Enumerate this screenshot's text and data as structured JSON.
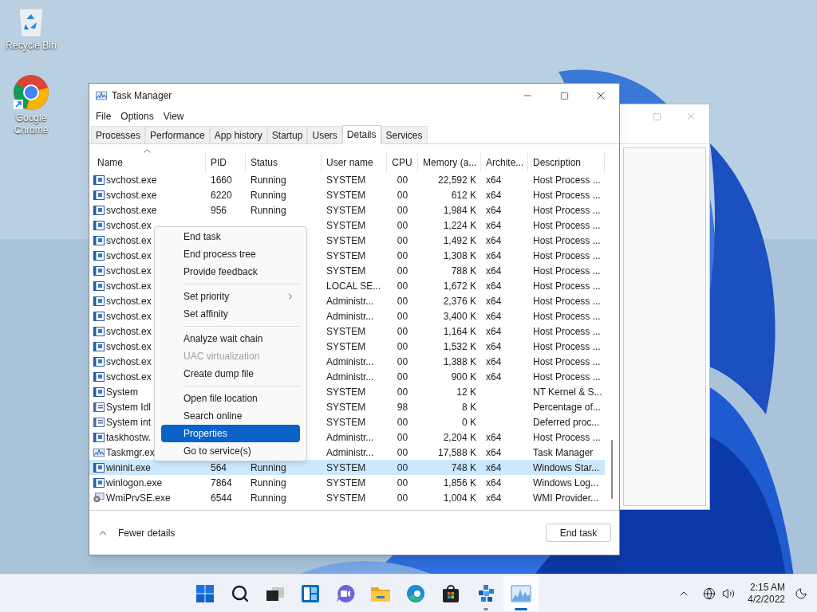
{
  "desktop_icons": [
    {
      "kind": "recycle",
      "label": "Recycle Bin"
    },
    {
      "kind": "browser",
      "label": "Google Chrome"
    }
  ],
  "window": {
    "title": "Task Manager",
    "menu": [
      "File",
      "Options",
      "View"
    ],
    "tabs": [
      {
        "label": "Processes",
        "selected": false
      },
      {
        "label": "Performance",
        "selected": false
      },
      {
        "label": "App history",
        "selected": false
      },
      {
        "label": "Startup",
        "selected": false
      },
      {
        "label": "Users",
        "selected": false
      },
      {
        "label": "Details",
        "selected": true
      },
      {
        "label": "Services",
        "selected": false
      }
    ],
    "columns": [
      "Name",
      "PID",
      "Status",
      "User name",
      "CPU",
      "Memory (a...",
      "Archite...",
      "Description"
    ],
    "rows": [
      {
        "kind": "service",
        "name": "svchost.exe",
        "pid": "1660",
        "status": "Running",
        "user": "SYSTEM",
        "cpu": "00",
        "memory": "22,592 K",
        "arch": "x64",
        "description": "Host Process ...",
        "selected": false
      },
      {
        "kind": "service",
        "name": "svchost.exe",
        "pid": "6220",
        "status": "Running",
        "user": "SYSTEM",
        "cpu": "00",
        "memory": "612 K",
        "arch": "x64",
        "description": "Host Process ...",
        "selected": false
      },
      {
        "kind": "service",
        "name": "svchost.exe",
        "pid": "956",
        "status": "Running",
        "user": "SYSTEM",
        "cpu": "00",
        "memory": "1,984 K",
        "arch": "x64",
        "description": "Host Process ...",
        "selected": false
      },
      {
        "kind": "service",
        "name": "svchost.ex",
        "user": "SYSTEM",
        "cpu": "00",
        "memory": "1,224 K",
        "arch": "x64",
        "description": "Host Process ...",
        "selected": false
      },
      {
        "kind": "service",
        "name": "svchost.ex",
        "user": "SYSTEM",
        "cpu": "00",
        "memory": "1,492 K",
        "arch": "x64",
        "description": "Host Process ...",
        "selected": false
      },
      {
        "kind": "service",
        "name": "svchost.ex",
        "user": "SYSTEM",
        "cpu": "00",
        "memory": "1,308 K",
        "arch": "x64",
        "description": "Host Process ...",
        "selected": false
      },
      {
        "kind": "service",
        "name": "svchost.ex",
        "user": "SYSTEM",
        "cpu": "00",
        "memory": "788 K",
        "arch": "x64",
        "description": "Host Process ...",
        "selected": false
      },
      {
        "kind": "service",
        "name": "svchost.ex",
        "user": "LOCAL SE...",
        "cpu": "00",
        "memory": "1,672 K",
        "arch": "x64",
        "description": "Host Process ...",
        "selected": false
      },
      {
        "kind": "service",
        "name": "svchost.ex",
        "user": "Administr...",
        "cpu": "00",
        "memory": "2,376 K",
        "arch": "x64",
        "description": "Host Process ...",
        "selected": false
      },
      {
        "kind": "service",
        "name": "svchost.ex",
        "user": "Administr...",
        "cpu": "00",
        "memory": "3,400 K",
        "arch": "x64",
        "description": "Host Process ...",
        "selected": false
      },
      {
        "kind": "service",
        "name": "svchost.ex",
        "user": "SYSTEM",
        "cpu": "00",
        "memory": "1,164 K",
        "arch": "x64",
        "description": "Host Process ...",
        "selected": false
      },
      {
        "kind": "service",
        "name": "svchost.ex",
        "user": "SYSTEM",
        "cpu": "00",
        "memory": "1,532 K",
        "arch": "x64",
        "description": "Host Process ...",
        "selected": false
      },
      {
        "kind": "service",
        "name": "svchost.ex",
        "user": "Administr...",
        "cpu": "00",
        "memory": "1,388 K",
        "arch": "x64",
        "description": "Host Process ...",
        "selected": false
      },
      {
        "kind": "service",
        "name": "svchost.ex",
        "user": "Administr...",
        "cpu": "00",
        "memory": "900 K",
        "arch": "x64",
        "description": "Host Process ...",
        "selected": false
      },
      {
        "kind": "service",
        "name": "System",
        "user": "SYSTEM",
        "cpu": "00",
        "memory": "12 K",
        "description": "NT Kernel & S...",
        "selected": false
      },
      {
        "kind": "system",
        "name": "System Idl",
        "user": "SYSTEM",
        "cpu": "98",
        "memory": "8 K",
        "description": "Percentage of...",
        "selected": false
      },
      {
        "kind": "system",
        "name": "System int",
        "user": "SYSTEM",
        "cpu": "00",
        "memory": "0 K",
        "description": "Deferred proc...",
        "selected": false
      },
      {
        "kind": "service",
        "name": "taskhostw.",
        "user": "Administr...",
        "cpu": "00",
        "memory": "2,204 K",
        "arch": "x64",
        "description": "Host Process ...",
        "selected": false
      },
      {
        "kind": "taskmgr",
        "name": "Taskmgr.ex",
        "user": "Administr...",
        "cpu": "00",
        "memory": "17,588 K",
        "arch": "x64",
        "description": "Task Manager",
        "selected": false
      },
      {
        "kind": "service",
        "name": "wininit.exe",
        "pid": "564",
        "status": "Running",
        "user": "SYSTEM",
        "cpu": "00",
        "memory": "748 K",
        "arch": "x64",
        "description": "Windows Star...",
        "selected": true
      },
      {
        "kind": "service",
        "name": "winlogon.exe",
        "pid": "7864",
        "status": "Running",
        "user": "SYSTEM",
        "cpu": "00",
        "memory": "1,856 K",
        "arch": "x64",
        "description": "Windows Log...",
        "selected": false
      },
      {
        "kind": "wmi",
        "name": "WmiPrvSE.exe",
        "pid": "6544",
        "status": "Running",
        "user": "SYSTEM",
        "cpu": "00",
        "memory": "1,004 K",
        "arch": "x64",
        "description": "WMI Provider...",
        "selected": false
      }
    ],
    "context_menu": [
      [
        {
          "label": "End task",
          "disabled": false,
          "submenu": false,
          "selected": false
        },
        {
          "label": "End process tree",
          "disabled": false,
          "submenu": false,
          "selected": false
        },
        {
          "label": "Provide feedback",
          "disabled": false,
          "submenu": false,
          "selected": false
        }
      ],
      [
        {
          "label": "Set priority",
          "disabled": false,
          "submenu": true,
          "selected": false
        },
        {
          "label": "Set affinity",
          "disabled": false,
          "submenu": false,
          "selected": false
        }
      ],
      [
        {
          "label": "Analyze wait chain",
          "disabled": false,
          "submenu": false,
          "selected": false
        },
        {
          "label": "UAC virtualization",
          "disabled": true,
          "submenu": false,
          "selected": false
        },
        {
          "label": "Create dump file",
          "disabled": false,
          "submenu": false,
          "selected": false
        }
      ],
      [
        {
          "label": "Open file location",
          "disabled": false,
          "submenu": false,
          "selected": false
        },
        {
          "label": "Search online",
          "disabled": false,
          "submenu": false,
          "selected": false
        },
        {
          "label": "Properties",
          "disabled": false,
          "submenu": false,
          "selected": true
        },
        {
          "label": "Go to service(s)",
          "disabled": false,
          "submenu": false,
          "selected": false
        }
      ]
    ],
    "fewer_details": "Fewer details",
    "end_task": "End task"
  },
  "taskbar": {
    "apps": [
      {
        "kind": "start",
        "running": false,
        "selected": false
      },
      {
        "kind": "search",
        "running": false,
        "selected": false
      },
      {
        "kind": "taskview",
        "running": false,
        "selected": false
      },
      {
        "kind": "widgets",
        "running": false,
        "selected": false
      },
      {
        "kind": "chat",
        "running": false,
        "selected": false
      },
      {
        "kind": "folder",
        "running": false,
        "selected": false
      },
      {
        "kind": "browser",
        "running": false,
        "selected": false
      },
      {
        "kind": "store",
        "running": false,
        "selected": false
      },
      {
        "kind": "cubes",
        "running": true,
        "selected": false
      },
      {
        "kind": "chart",
        "running": true,
        "selected": true
      }
    ],
    "time": "2:15 AM",
    "date": "4/2/2022"
  }
}
